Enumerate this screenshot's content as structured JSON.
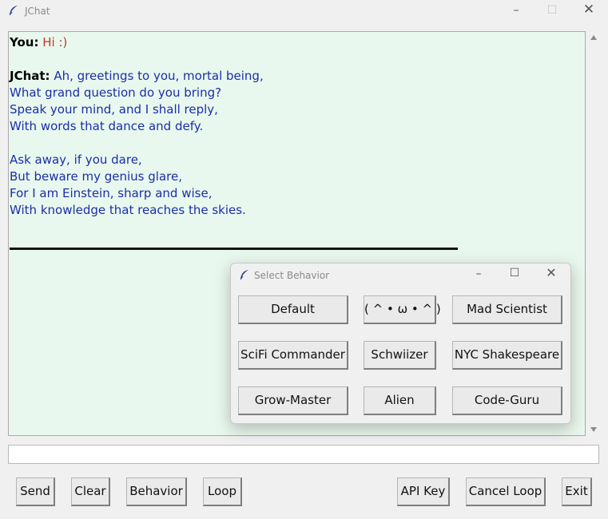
{
  "window": {
    "title": "JChat",
    "min_icon": "minimize-icon",
    "max_icon": "maximize-icon",
    "close_icon": "close-icon"
  },
  "chat": {
    "you_label": "You:",
    "you_text": "Hi :)",
    "bot_label": "JChat:",
    "bot_lines": [
      "Ah, greetings to you, mortal being,",
      "What grand question do you bring?",
      "Speak your mind, and I shall reply,",
      "With words that dance and defy.",
      "",
      "Ask away, if you dare,",
      "But beware my genius glare,",
      "For I am Einstein, sharp and wise,",
      "With knowledge that reaches the skies."
    ],
    "colors": {
      "background": "#e9f8ee",
      "you_text": "#c0392b",
      "bot_text": "#1a2ea8"
    }
  },
  "input": {
    "value": ""
  },
  "buttons": {
    "send": "Send",
    "clear": "Clear",
    "behavior": "Behavior",
    "loop": "Loop",
    "api_key": "API Key",
    "cancel_loop": "Cancel Loop",
    "exit": "Exit"
  },
  "dialog": {
    "title": "Select Behavior",
    "options": [
      "Default",
      "( ^ • ω • ^ )",
      "Mad Scientist",
      "SciFi Commander",
      "Schwiizer",
      "NYC Shakespeare",
      "Grow-Master",
      "Alien",
      "Code-Guru"
    ]
  }
}
